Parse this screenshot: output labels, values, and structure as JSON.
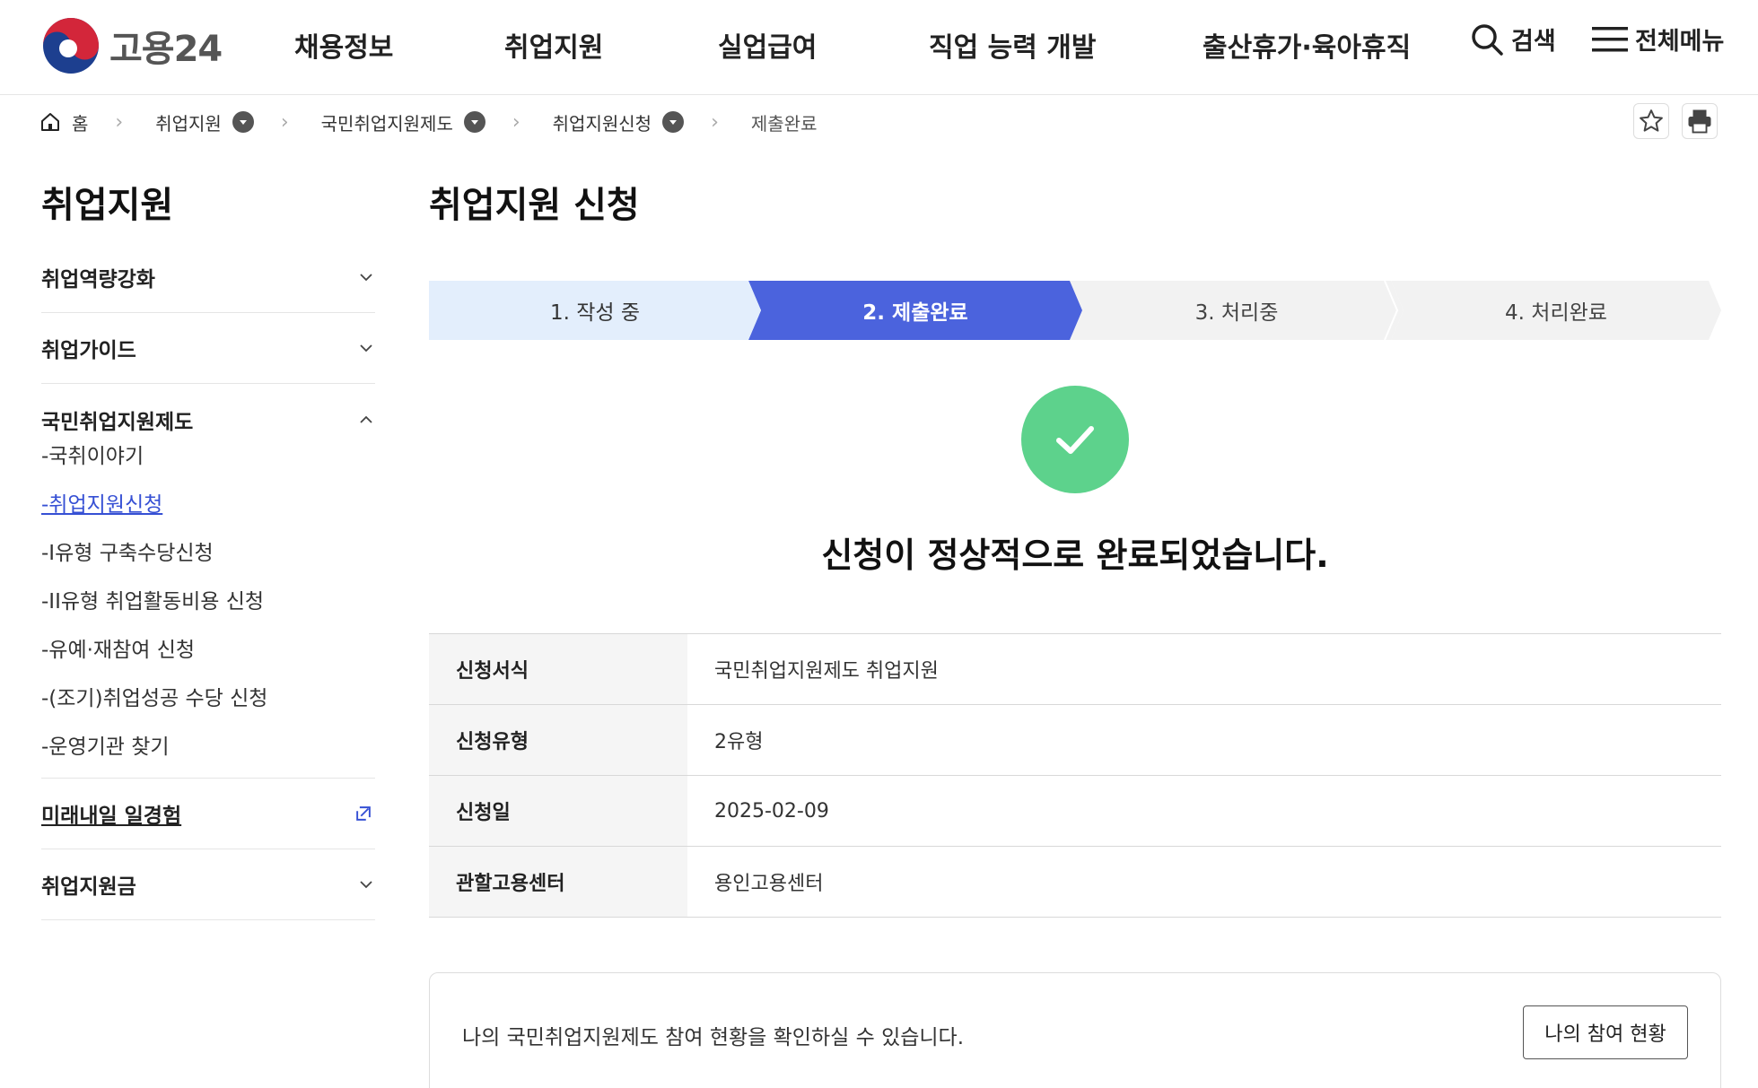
{
  "header": {
    "logo_text": "고용24",
    "nav": [
      "채용정보",
      "취업지원",
      "실업급여",
      "직업 능력 개발",
      "출산휴가·육아휴직"
    ],
    "search_label": "검색",
    "menu_label": "전체메뉴"
  },
  "breadcrumb": {
    "home": "홈",
    "items": [
      "취업지원",
      "국민취업지원제도",
      "취업지원신청"
    ],
    "current": "제출완료"
  },
  "sidebar": {
    "title": "취업지원",
    "items": [
      {
        "label": "취업역량강화"
      },
      {
        "label": "취업가이드"
      },
      {
        "label": "국민취업지원제도"
      },
      {
        "label": "미래내일 일경험"
      },
      {
        "label": "취업지원금"
      }
    ],
    "sub_items": [
      "-국취이야기",
      "-취업지원신청",
      "-I유형 구축수당신청",
      "-II유형 취업활동비용 신청",
      "-유예·재참여 신청",
      "-(조기)취업성공 수당 신청",
      "-운영기관 찾기"
    ]
  },
  "main": {
    "title": "취업지원 신청",
    "steps": [
      "1. 작성 중",
      "2. 제출완료",
      "3. 처리중",
      "4. 처리완료"
    ],
    "active_step": 2,
    "success_message": "신청이 정상적으로 완료되었습니다.",
    "info": [
      {
        "label": "신청서식",
        "value": "국민취업지원제도 취업지원"
      },
      {
        "label": "신청유형",
        "value": "2유형"
      },
      {
        "label": "신청일",
        "value": "2025-02-09"
      },
      {
        "label": "관할고용센터",
        "value": "용인고용센터"
      }
    ],
    "notice_text": "나의 국민취업지원제도 참여 현황을 확인하실 수 있습니다.",
    "notice_button": "나의 참여 현황"
  },
  "colors": {
    "accent": "#4b63dd",
    "step_done": "#e3eefc",
    "success": "#5dd28c",
    "link": "#3650d4"
  }
}
